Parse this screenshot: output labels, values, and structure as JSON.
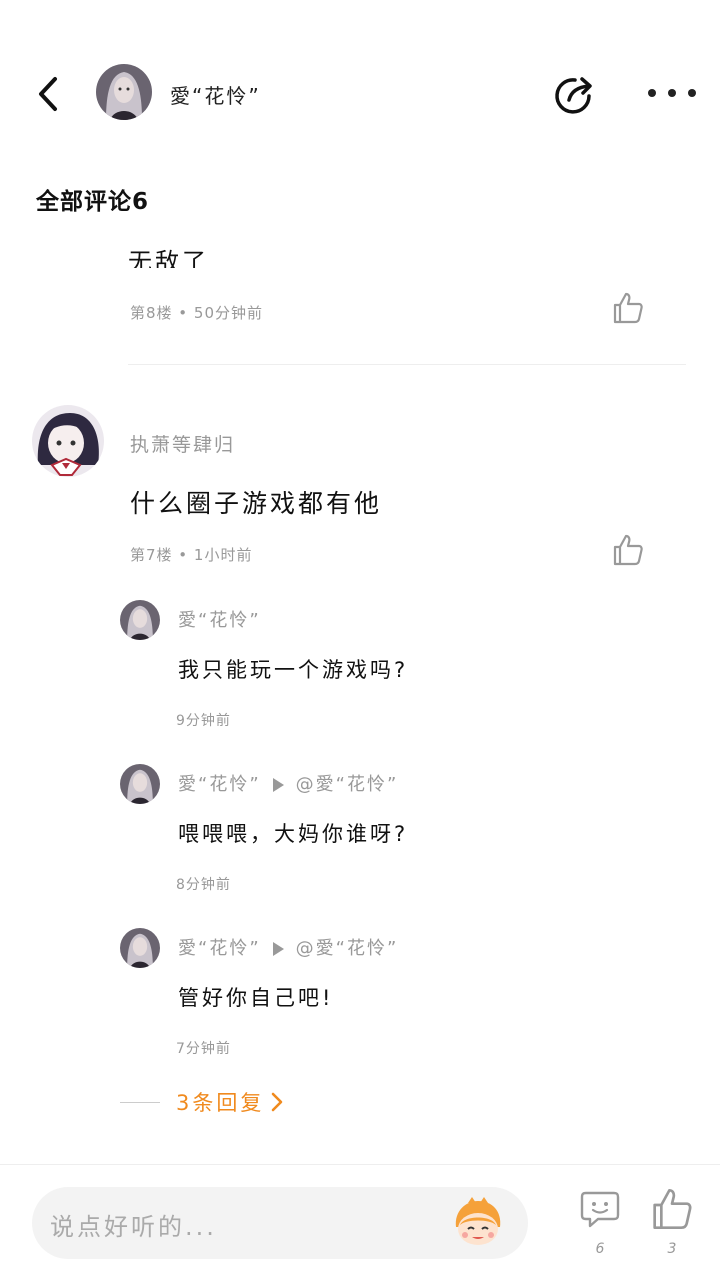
{
  "header": {
    "name": "愛“花怜”",
    "icons": {
      "back": "chevron-left-icon",
      "share": "share-icon",
      "more": "more-dots-icon"
    }
  },
  "section": {
    "title": "全部评论6"
  },
  "previous_comment": {
    "text_tail": "无敌了",
    "meta": "第8楼 • 50分钟前"
  },
  "comment": {
    "user": "执萧等肆归",
    "text": "什么圈子游戏都有他",
    "meta": "第7楼 • 1小时前"
  },
  "replies": [
    {
      "user": "愛“花怜”",
      "reply_to": "",
      "text": "我只能玩一个游戏吗?",
      "time": "9分钟前"
    },
    {
      "user": "愛“花怜”",
      "reply_to": "@愛“花怜”",
      "text": "喂喂喂，大妈你谁呀?",
      "time": "8分钟前"
    },
    {
      "user": "愛“花怜”",
      "reply_to": "@愛“花怜”",
      "text": "管好你自己吧!",
      "time": "7分钟前"
    }
  ],
  "more_replies": {
    "label": "3条回复"
  },
  "bottom_bar": {
    "placeholder": "说点好听的...",
    "comment_count": "6",
    "like_count": "3"
  },
  "colors": {
    "accent": "#f08a1e",
    "muted": "#999999",
    "text": "#111111"
  }
}
